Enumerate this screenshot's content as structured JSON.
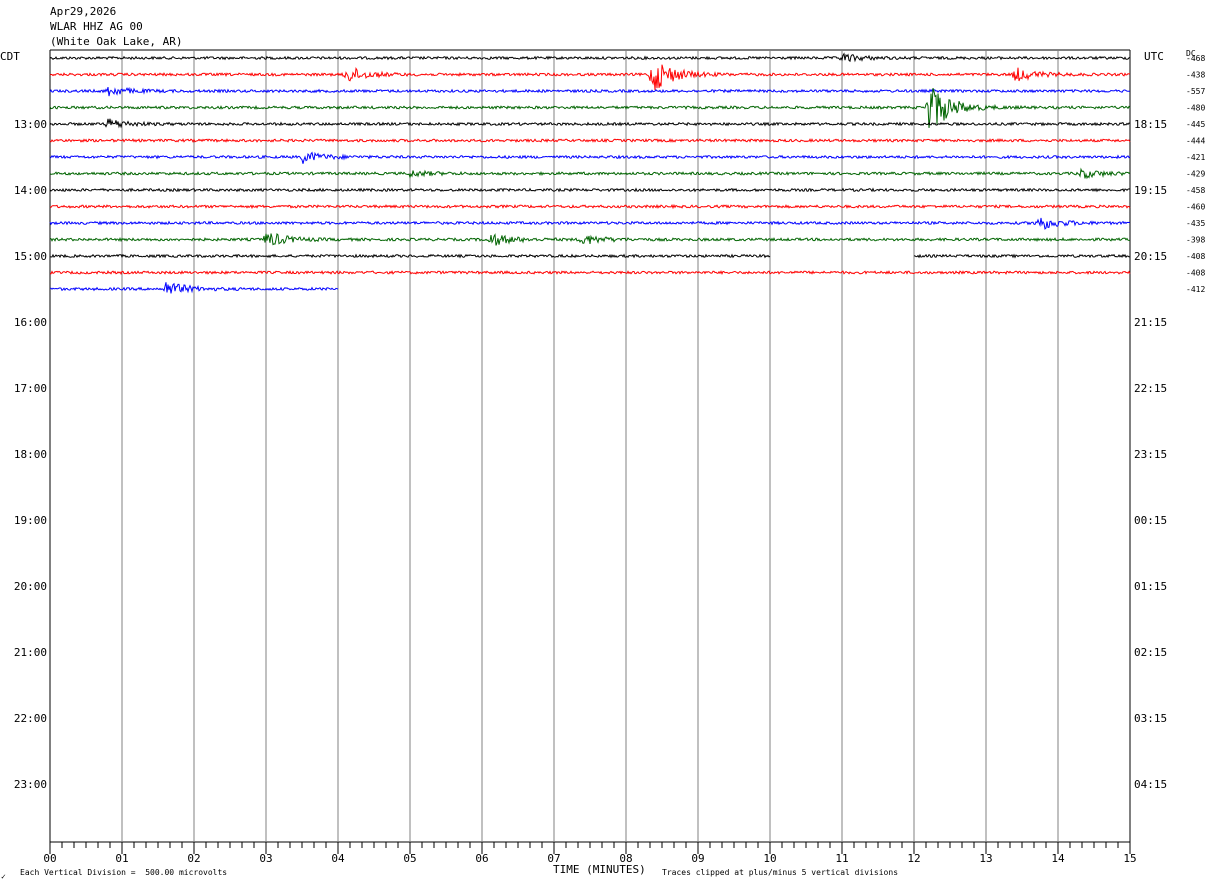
{
  "header": {
    "date": "Apr29,2026",
    "station": "WLAR HHZ AG 00",
    "location": "(White Oak Lake, AR)"
  },
  "labels": {
    "left_tz": "CDT",
    "right_tz": "UTC",
    "dc": "DC",
    "vertical_division": "Each Vertical Division =  500.00 microvolts",
    "clip_note": "Traces clipped at plus/minus 5 vertical divisions",
    "corner_mark": "✓"
  },
  "chart_data": {
    "type": "line",
    "title": "Apr29,2026 WLAR HHZ AG 00 (White Oak Lake, AR)",
    "xlabel": "TIME (MINUTES)",
    "x_ticks": [
      "00",
      "01",
      "02",
      "03",
      "04",
      "05",
      "06",
      "07",
      "08",
      "09",
      "10",
      "11",
      "12",
      "13",
      "14",
      "15"
    ],
    "xlim": [
      0,
      15
    ],
    "left_hour_labels": [
      "13:00",
      "14:00",
      "15:00",
      "16:00",
      "17:00",
      "18:00",
      "19:00",
      "20:00",
      "21:00",
      "22:00",
      "23:00"
    ],
    "right_hour_labels": [
      "18:15",
      "19:15",
      "20:15",
      "21:15",
      "22:15",
      "23:15",
      "00:15",
      "01:15",
      "02:15",
      "03:15",
      "04:15"
    ],
    "trace_colors": [
      "#000000",
      "#ff0000",
      "#0000ff",
      "#006400"
    ],
    "dc_offsets": [
      "-468",
      "-438",
      "-557",
      "-480",
      "-445",
      "-444",
      "-421",
      "-429",
      "-458",
      "-460",
      "-435",
      "-398",
      "-408",
      "-408",
      "-412"
    ],
    "traces": [
      {
        "segments": [
          [
            0,
            15
          ]
        ],
        "events": [
          {
            "t": 11.0,
            "amp": 4
          }
        ]
      },
      {
        "segments": [
          [
            0,
            15
          ]
        ],
        "events": [
          {
            "t": 4.1,
            "amp": 9
          },
          {
            "t": 8.35,
            "amp": 20
          },
          {
            "t": 13.4,
            "amp": 7
          }
        ]
      },
      {
        "segments": [
          [
            0,
            15
          ]
        ],
        "events": [
          {
            "t": 0.8,
            "amp": 5
          }
        ]
      },
      {
        "segments": [
          [
            0,
            15
          ]
        ],
        "events": [
          {
            "t": 12.2,
            "amp": 28
          }
        ]
      },
      {
        "segments": [
          [
            0,
            15
          ]
        ],
        "events": [
          {
            "t": 0.8,
            "amp": 5
          }
        ]
      },
      {
        "segments": [
          [
            0,
            15
          ]
        ],
        "events": []
      },
      {
        "segments": [
          [
            0,
            15
          ]
        ],
        "events": [
          {
            "t": 3.5,
            "amp": 6
          }
        ]
      },
      {
        "segments": [
          [
            0,
            15
          ]
        ],
        "events": [
          {
            "t": 5.0,
            "amp": 3
          },
          {
            "t": 14.3,
            "amp": 5
          }
        ]
      },
      {
        "segments": [
          [
            0,
            15
          ]
        ],
        "events": []
      },
      {
        "segments": [
          [
            0,
            15
          ]
        ],
        "events": []
      },
      {
        "segments": [
          [
            0,
            15
          ]
        ],
        "events": [
          {
            "t": 13.7,
            "amp": 8
          }
        ]
      },
      {
        "segments": [
          [
            0,
            15
          ]
        ],
        "events": [
          {
            "t": 3.0,
            "amp": 8
          },
          {
            "t": 6.1,
            "amp": 7
          },
          {
            "t": 7.4,
            "amp": 5
          }
        ]
      },
      {
        "segments": [
          [
            0,
            10
          ],
          [
            12,
            15
          ]
        ],
        "events": []
      },
      {
        "segments": [
          [
            0,
            15
          ]
        ],
        "events": []
      },
      {
        "segments": [
          [
            0,
            4
          ]
        ],
        "events": [
          {
            "t": 1.6,
            "amp": 8
          }
        ]
      }
    ]
  }
}
